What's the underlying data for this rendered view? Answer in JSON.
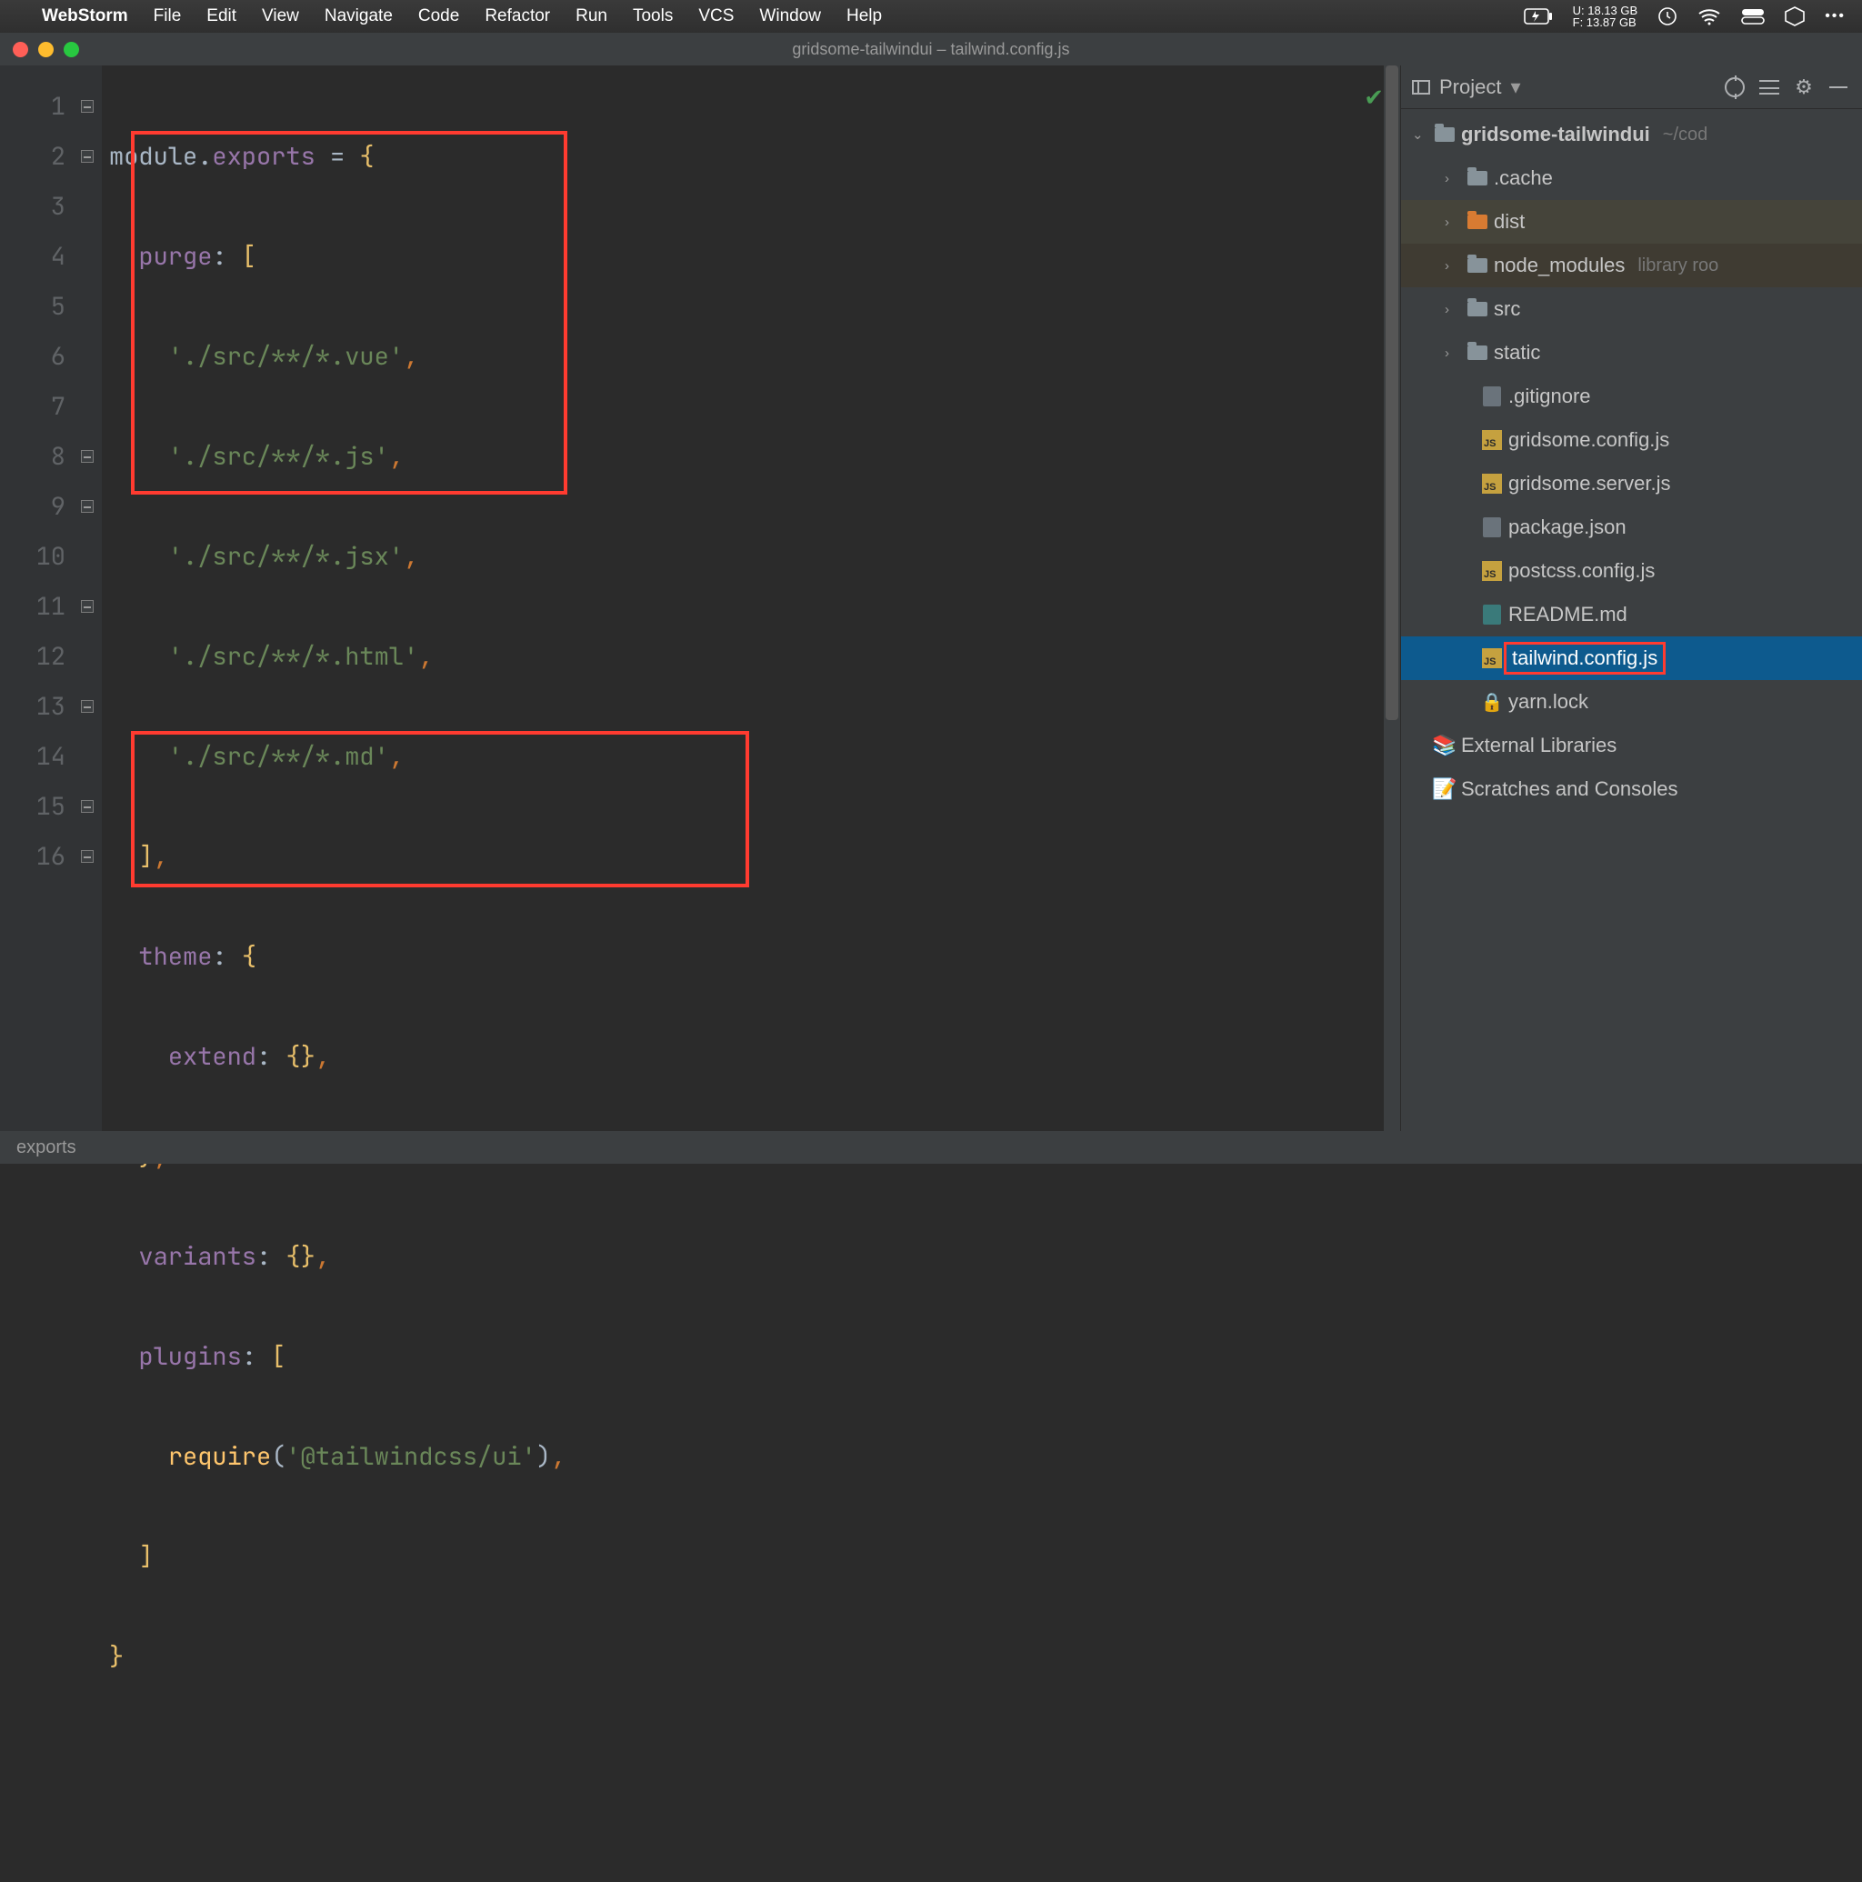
{
  "menubar": {
    "app": "WebStorm",
    "items": [
      "File",
      "Edit",
      "View",
      "Navigate",
      "Code",
      "Refactor",
      "Run",
      "Tools",
      "VCS",
      "Window",
      "Help"
    ],
    "disk_u": "U: 18.13 GB",
    "disk_f": "F: 13.87 GB"
  },
  "window": {
    "title": "gridsome-tailwindui – tailwind.config.js"
  },
  "editor": {
    "lines": [
      "1",
      "2",
      "3",
      "4",
      "5",
      "6",
      "7",
      "8",
      "9",
      "10",
      "11",
      "12",
      "13",
      "14",
      "15",
      "16"
    ],
    "code": {
      "l1": {
        "a": "module",
        "b": ".",
        "c": "exports",
        "d": " = ",
        "e": "{"
      },
      "l2": {
        "a": "purge",
        "b": ": ",
        "c": "["
      },
      "l3": {
        "a": "'./src/**/*.vue'",
        "b": ","
      },
      "l4": {
        "a": "'./src/**/*.js'",
        "b": ","
      },
      "l5": {
        "a": "'./src/**/*.jsx'",
        "b": ","
      },
      "l6": {
        "a": "'./src/**/*.html'",
        "b": ","
      },
      "l7": {
        "a": "'./src/**/*.md'",
        "b": ","
      },
      "l8": {
        "a": "]",
        "b": ","
      },
      "l9": {
        "a": "theme",
        "b": ": ",
        "c": "{"
      },
      "l10": {
        "a": "extend",
        "b": ": ",
        "c": "{}",
        "d": ","
      },
      "l11": {
        "a": "}",
        "b": ","
      },
      "l12": {
        "a": "variants",
        "b": ": ",
        "c": "{}",
        "d": ","
      },
      "l13": {
        "a": "plugins",
        "b": ": ",
        "c": "["
      },
      "l14": {
        "a": "require",
        "b": "(",
        "c": "'@tailwindcss/ui'",
        "d": ")",
        "e": ","
      },
      "l15": {
        "a": "]"
      },
      "l16": {
        "a": "}"
      }
    }
  },
  "sidebar": {
    "title": "Project",
    "root": {
      "name": "gridsome-tailwindui",
      "hint": "~/cod"
    },
    "folders": {
      "cache": ".cache",
      "dist": "dist",
      "node_modules": "node_modules",
      "node_modules_hint": "library roo",
      "src": "src",
      "static": "static"
    },
    "files": {
      "gitignore": ".gitignore",
      "gridsome_config": "gridsome.config.js",
      "gridsome_server": "gridsome.server.js",
      "package": "package.json",
      "postcss": "postcss.config.js",
      "readme": "README.md",
      "tailwind": "tailwind.config.js",
      "yarn": "yarn.lock"
    },
    "external": "External Libraries",
    "scratches": "Scratches and Consoles"
  },
  "statusbar": {
    "breadcrumb": "exports"
  }
}
